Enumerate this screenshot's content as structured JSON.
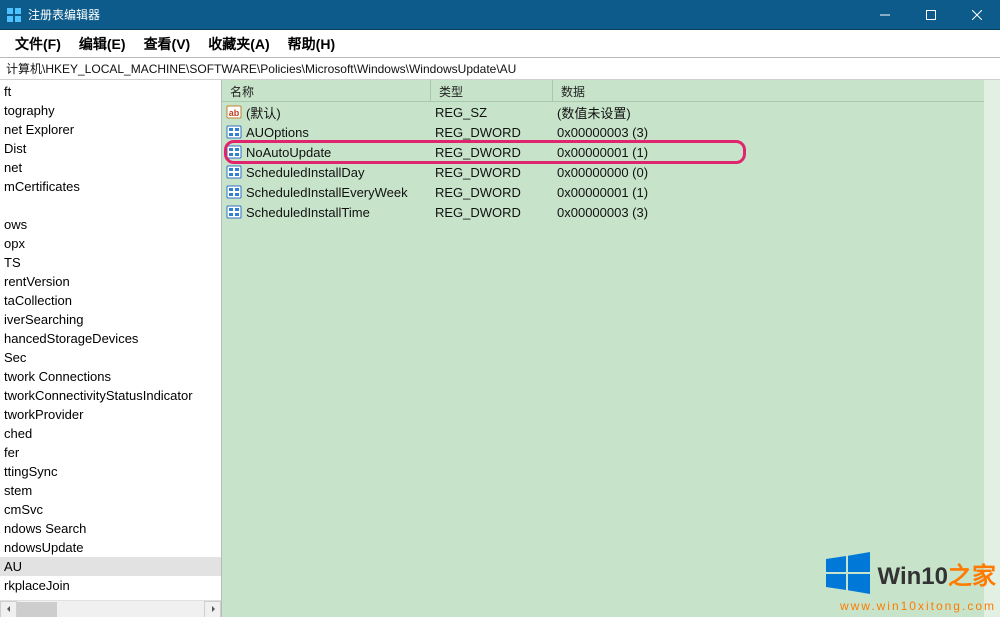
{
  "window": {
    "title": "注册表编辑器"
  },
  "menu": {
    "file": "文件(F)",
    "edit": "编辑(E)",
    "view": "查看(V)",
    "favorites": "收藏夹(A)",
    "help": "帮助(H)"
  },
  "address": "计算机\\HKEY_LOCAL_MACHINE\\SOFTWARE\\Policies\\Microsoft\\Windows\\WindowsUpdate\\AU",
  "tree": {
    "items": [
      "ft",
      "tography",
      "net Explorer",
      "Dist",
      "net",
      "mCertificates",
      "",
      "ows",
      "opx",
      "TS",
      "rentVersion",
      "taCollection",
      "iverSearching",
      "hancedStorageDevices",
      "Sec",
      "twork Connections",
      "tworkConnectivityStatusIndicator",
      "tworkProvider",
      "ched",
      "fer",
      "ttingSync",
      "stem",
      "cmSvc",
      "ndows Search",
      "ndowsUpdate",
      "AU",
      "rkplaceJoin"
    ],
    "selected_index": 25
  },
  "columns": {
    "name": "名称",
    "type": "类型",
    "data": "数据"
  },
  "rows": [
    {
      "icon": "ab",
      "name": "(默认)",
      "type": "REG_SZ",
      "data": "(数值未设置)"
    },
    {
      "icon": "num",
      "name": "AUOptions",
      "type": "REG_DWORD",
      "data": "0x00000003 (3)"
    },
    {
      "icon": "num",
      "name": "NoAutoUpdate",
      "type": "REG_DWORD",
      "data": "0x00000001 (1)",
      "highlighted": true
    },
    {
      "icon": "num",
      "name": "ScheduledInstallDay",
      "type": "REG_DWORD",
      "data": "0x00000000 (0)"
    },
    {
      "icon": "num",
      "name": "ScheduledInstallEveryWeek",
      "type": "REG_DWORD",
      "data": "0x00000001 (1)"
    },
    {
      "icon": "num",
      "name": "ScheduledInstallTime",
      "type": "REG_DWORD",
      "data": "0x00000003 (3)"
    }
  ],
  "watermark": {
    "brand1": "Win10",
    "brand2": "之家",
    "url": "www.win10xitong.com"
  }
}
